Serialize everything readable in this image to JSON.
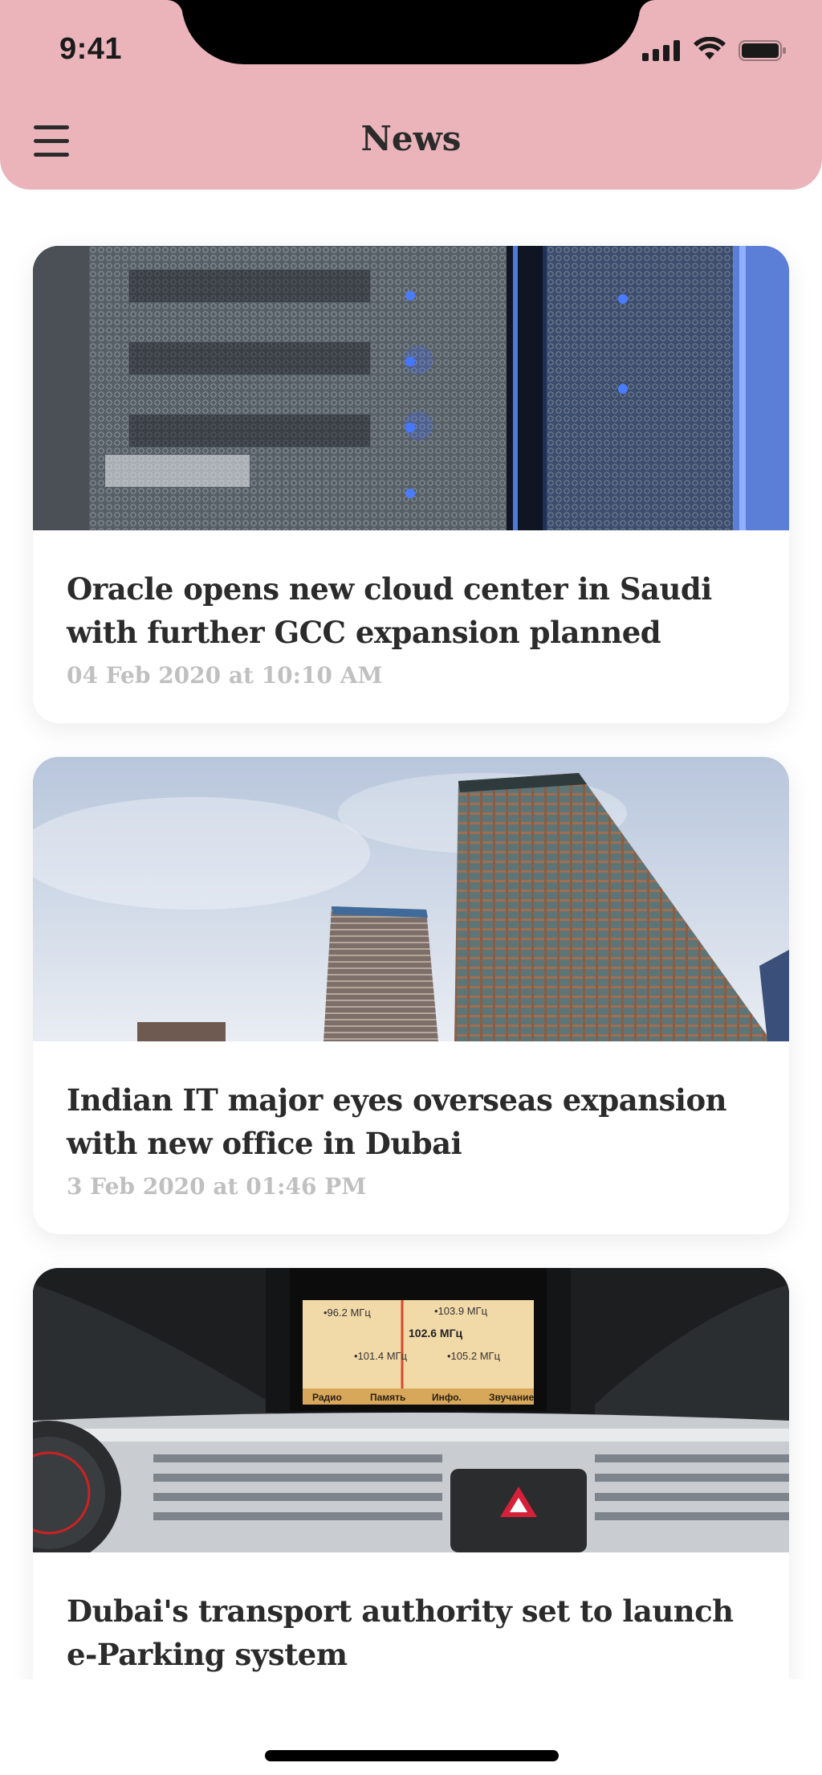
{
  "status_bar": {
    "time": "9:41",
    "icons": [
      "signal-icon",
      "wifi-icon",
      "battery-icon"
    ]
  },
  "header": {
    "title": "News",
    "menu_icon": "hamburger-menu-icon",
    "background_color": "#ebb4bb"
  },
  "articles": [
    {
      "title": "Oracle opens new cloud center in Saudi with further GCC expansion planned",
      "date": "04 Feb 2020 at 10:10 AM",
      "image": "server-rack-image"
    },
    {
      "title": "Indian IT major eyes overseas expansion with new office in Dubai",
      "date": "3 Feb 2020 at 01:46 PM",
      "image": "skyscrapers-image"
    },
    {
      "title": "Dubai's transport authority set to launch e-Parking system",
      "date": "",
      "image": "car-dashboard-image",
      "radio": {
        "freq_1": "•96.2 МГц",
        "freq_2": "•103.9 МГц",
        "freq_3": "102.6 МГц",
        "freq_4": "•101.4 МГц",
        "freq_5": "•105.2 МГц",
        "tabs": [
          "Радио",
          "Память",
          "Инфо.",
          "Звучание"
        ]
      }
    }
  ],
  "colors": {
    "title_text": "#2b2b2b",
    "date_text": "#c0c0c0",
    "card_background": "#ffffff"
  }
}
